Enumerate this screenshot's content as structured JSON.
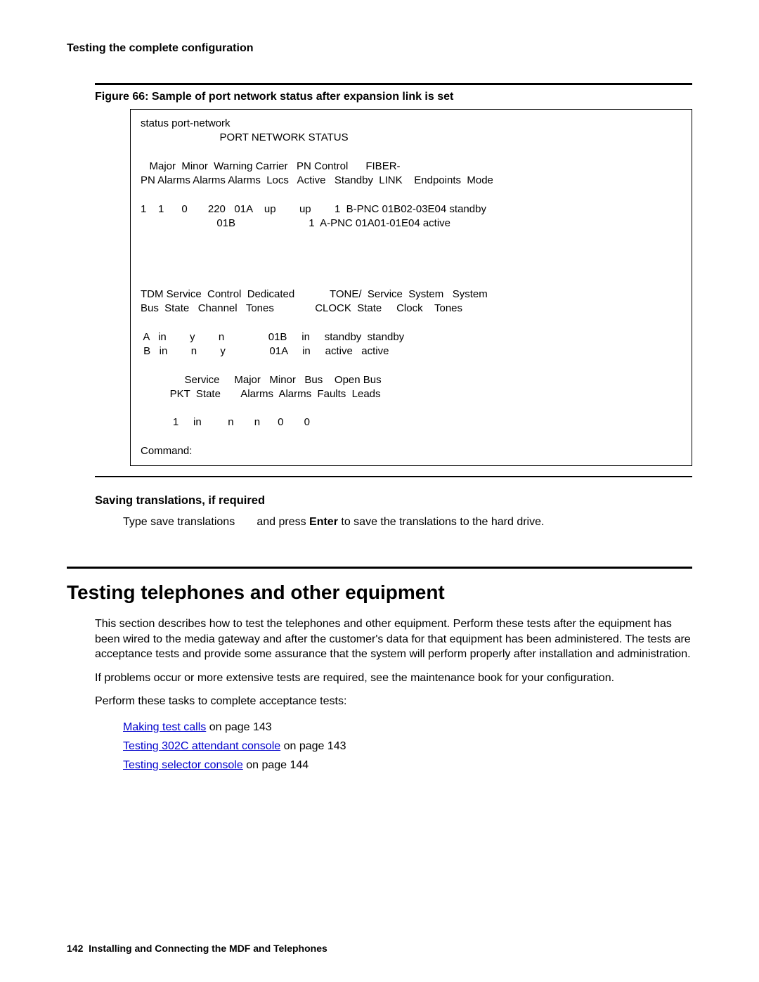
{
  "header_title": "Testing the complete configuration",
  "figure_caption": "Figure 66: Sample of port network status after expansion link is set",
  "terminal": "status port-network\n                           PORT NETWORK STATUS\n\n   Major  Minor  Warning Carrier   PN Control      FIBER-\nPN Alarms Alarms Alarms  Locs   Active   Standby  LINK    Endpoints  Mode\n\n1    1      0       220   01A    up        up        1  B-PNC 01B02-03E04 standby\n                          01B                         1  A-PNC 01A01-01E04 active\n\n\n\n\nTDM Service  Control  Dedicated            TONE/  Service  System   System\nBus  State   Channel   Tones              CLOCK  State     Clock    Tones\n\n A   in        y        n               01B     in     standby  standby\n B   in        n        y               01A     in     active   active\n\n               Service     Major   Minor   Bus    Open Bus\n          PKT  State       Alarms  Alarms  Faults  Leads\n\n           1     in         n       n      0       0\n\nCommand:",
  "saving_heading": "Saving translations, if required",
  "saving_instruction_prefix": "Type ",
  "saving_instruction_cmd": "save translations",
  "saving_instruction_mid": " and press ",
  "saving_instruction_bold": "Enter",
  "saving_instruction_suffix": " to save the translations to the hard drive.",
  "main_heading": "Testing telephones and other equipment",
  "para1": "This section describes how to test the telephones and other equipment. Perform these tests after the equipment has been wired to the media gateway and after the customer's data for that equipment has been administered. The tests are acceptance tests and provide some assurance that the system will perform properly after installation and administration.",
  "para2": "If problems occur or more extensive tests are required, see the maintenance book for your configuration.",
  "para3": "Perform these tasks to complete acceptance tests:",
  "tasks": [
    {
      "link": "Making test calls",
      "suffix": " on page 143"
    },
    {
      "link": "Testing 302C attendant console",
      "suffix": " on page 143"
    },
    {
      "link": "Testing selector console",
      "suffix": " on page 144"
    }
  ],
  "footer_pagenum": "142",
  "footer_text": "Installing and Connecting the MDF and Telephones"
}
